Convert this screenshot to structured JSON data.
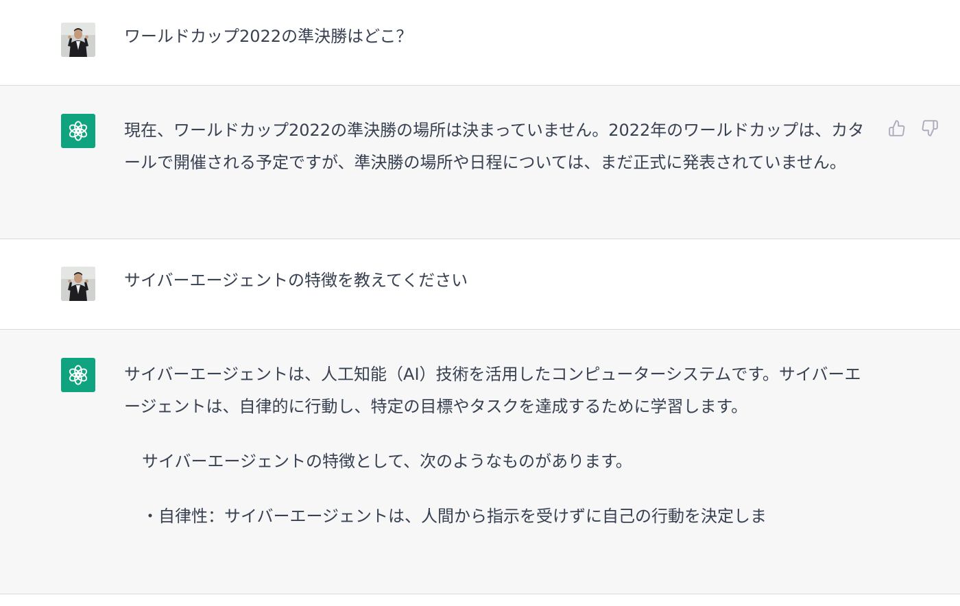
{
  "conversation": [
    {
      "role": "user",
      "text": "ワールドカップ2022の準決勝はどこ？"
    },
    {
      "role": "assistant",
      "text": "現在、ワールドカップ2022の準決勝の場所は決まっていません。2022年のワールドカップは、カタールで開催される予定ですが、準決勝の場所や日程については、まだ正式に発表されていません。"
    },
    {
      "role": "user",
      "text": "サイバーエージェントの特徴を教えてください"
    },
    {
      "role": "assistant",
      "paragraphs": [
        "サイバーエージェントは、人工知能（AI）技術を活用したコンピューターシステムです。サイバーエージェントは、自律的に行動し、特定の目標やタスクを達成するために学習します。",
        "サイバーエージェントの特徴として、次のようなものがあります。",
        "・自律性：サイバーエージェントは、人間から指示を受けずに自己の行動を決定しま"
      ]
    }
  ],
  "icons": {
    "thumbs_up": "thumbs-up-icon",
    "thumbs_down": "thumbs-down-icon",
    "assistant_logo": "openai-logo-icon",
    "user_avatar": "user-photo-avatar"
  },
  "colors": {
    "assistant_bg": "#f7f7f8",
    "user_bg": "#ffffff",
    "logo_bg": "#10a37f",
    "text": "#374151",
    "divider": "#d9d9e3",
    "icon_gray": "#acacbe"
  }
}
